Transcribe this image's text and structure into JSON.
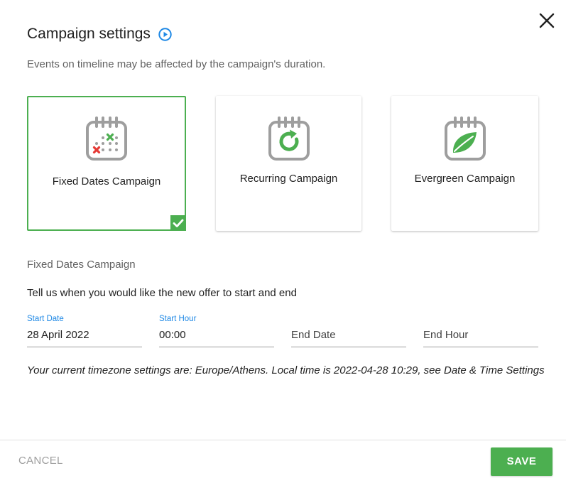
{
  "dialog": {
    "title": "Campaign settings",
    "subtitle": "Events on timeline may be affected by the campaign's duration."
  },
  "campaign_types": [
    {
      "label": "Fixed Dates Campaign",
      "icon": "calendar-fixed-dates-icon",
      "selected": true
    },
    {
      "label": "Recurring Campaign",
      "icon": "calendar-recurring-icon",
      "selected": false
    },
    {
      "label": "Evergreen Campaign",
      "icon": "calendar-evergreen-leaf-icon",
      "selected": false
    }
  ],
  "section": {
    "heading": "Fixed Dates Campaign",
    "prompt": "Tell us when you would like the new offer to start and end"
  },
  "fields": {
    "start_date": {
      "label": "Start Date",
      "value": "28 April 2022"
    },
    "start_hour": {
      "label": "Start Hour",
      "value": "00:00"
    },
    "end_date": {
      "placeholder": "End Date"
    },
    "end_hour": {
      "placeholder": "End Hour"
    }
  },
  "timezone_note": "Your current timezone settings are: Europe/Athens. Local time is 2022-04-28 10:29, see Date & Time Settings",
  "footer": {
    "cancel_label": "CANCEL",
    "save_label": "SAVE"
  },
  "colors": {
    "accent_green": "#4caf50",
    "label_blue": "#1e88e5",
    "play_blue": "#1e88e5",
    "icon_gray": "#9e9e9e",
    "cross_red": "#e53935"
  }
}
